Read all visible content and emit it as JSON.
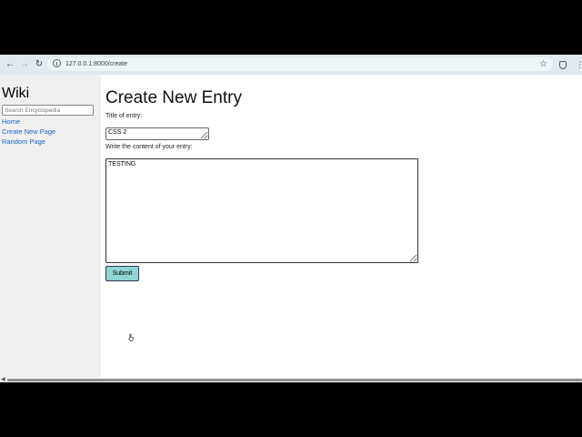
{
  "browser": {
    "url": "127.0.0.1:8000/create",
    "back_icon": "←",
    "forward_icon": "→",
    "reload_icon": "↻",
    "star_icon": "☆",
    "menu_icon": "⋮"
  },
  "sidebar": {
    "title": "Wiki",
    "search_placeholder": "Search Encyclopedia",
    "links": [
      "Home",
      "Create New Page",
      "Random Page"
    ]
  },
  "main": {
    "heading": "Create New Entry",
    "title_label": "Title of entry:",
    "title_value": "CSS 2",
    "content_label": "Write the content of your entry:",
    "content_value": "TESTING",
    "submit_label": "Submit"
  },
  "colors": {
    "sidebar_bg": "#f0f0f0",
    "link": "#1a66cc",
    "submit_bg": "#8fd6d1",
    "toolbar_bg": "#dfe9ee"
  }
}
